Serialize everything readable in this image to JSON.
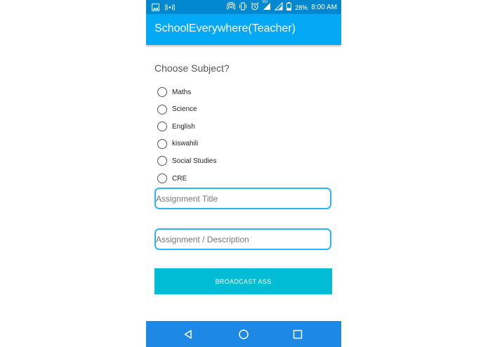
{
  "status_bar": {
    "icons_left": [
      "image-icon",
      "broadcast-icon"
    ],
    "icons_right": [
      "hotspot-icon",
      "vibrate-icon",
      "alarm-icon",
      "signal-icon",
      "battery-icon"
    ],
    "network": "3G",
    "battery": "28%",
    "time": "8:00 AM"
  },
  "appbar": {
    "title": "SchoolEverywhere(Teacher)"
  },
  "form": {
    "subject_question": "Choose Subject?",
    "subjects": [
      "Maths",
      "Science",
      "English",
      "kiswahili",
      "Social Studies",
      "CRE"
    ],
    "title_placeholder": "Assignment Title",
    "description_placeholder": "Assignment / Description",
    "submit_label": "BROADCAST ASS"
  },
  "navbar": {
    "buttons": [
      "back-icon",
      "home-icon",
      "recents-icon"
    ]
  },
  "colors": {
    "status_bar": "#0288d1",
    "app_bar": "#03a9f4",
    "field_border": "#29b6f6",
    "button": "#00bcd4",
    "nav_bar": "#1e88e5"
  }
}
